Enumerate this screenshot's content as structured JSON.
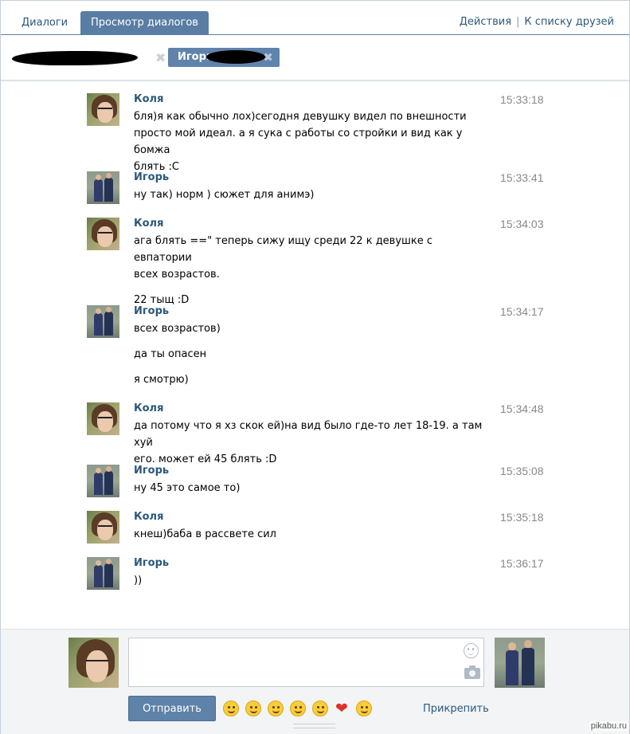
{
  "tabs": {
    "dialogs": "Диалоги",
    "view_dialogs": "Просмотр диалогов",
    "actions": "Действия",
    "to_friends": "К списку друзей",
    "separator": "|"
  },
  "chips": {
    "chip2_label": "Игорь",
    "close_glyph": "✖"
  },
  "messages": [
    {
      "author": "Коля",
      "time": "15:33:18",
      "lines": [
        "бля)я как обычно лох)сегодня девушку видел по внешности",
        "просто мой идеал. а я сука с работы со стройки и вид как у бомжа",
        "блять :С"
      ]
    },
    {
      "author": "Игорь",
      "time": "15:33:41",
      "lines": [
        "ну так) норм ) сюжет для анимэ)"
      ]
    },
    {
      "author": "Коля",
      "time": "15:34:03",
      "lines": [
        "ага блять ==\" теперь сижу ищу среди 22 к девушке с евпатории",
        "всех возрастов."
      ],
      "extra": "22 тыщ :D"
    },
    {
      "author": "Игорь",
      "time": "15:34:17",
      "lines": [
        "всех возрастов)"
      ],
      "extra": "да ты опасен",
      "extra2": "я смотрю)"
    },
    {
      "author": "Коля",
      "time": "15:34:48",
      "lines": [
        "да потому что я хз скок ей)на вид было где-то лет 18-19. а там хуй",
        "его. может ей 45 блять :D"
      ]
    },
    {
      "author": "Игорь",
      "time": "15:35:08",
      "lines": [
        "ну 45 это самое то)"
      ]
    },
    {
      "author": "Коля",
      "time": "15:35:18",
      "lines": [
        "кнеш)баба в рассвете сил"
      ]
    },
    {
      "author": "Игорь",
      "time": "15:36:17",
      "lines": [
        "))"
      ]
    }
  ],
  "composer": {
    "message_value": "",
    "send_label": "Отправить",
    "attach_label": "Прикрепить",
    "heart_glyph": "❤"
  },
  "watermark": "pikabu.ru",
  "colors": {
    "accent": "#597da3",
    "link": "#2b587a",
    "time": "#888888",
    "composer_bg": "#f2f4f6"
  }
}
